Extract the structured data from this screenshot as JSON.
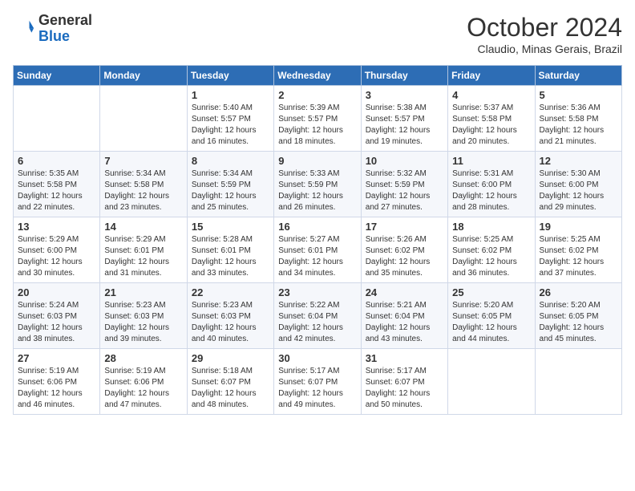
{
  "logo": {
    "general": "General",
    "blue": "Blue"
  },
  "header": {
    "month": "October 2024",
    "location": "Claudio, Minas Gerais, Brazil"
  },
  "days_of_week": [
    "Sunday",
    "Monday",
    "Tuesday",
    "Wednesday",
    "Thursday",
    "Friday",
    "Saturday"
  ],
  "weeks": [
    [
      {
        "day": "",
        "content": ""
      },
      {
        "day": "",
        "content": ""
      },
      {
        "day": "1",
        "content": "Sunrise: 5:40 AM\nSunset: 5:57 PM\nDaylight: 12 hours\nand 16 minutes."
      },
      {
        "day": "2",
        "content": "Sunrise: 5:39 AM\nSunset: 5:57 PM\nDaylight: 12 hours\nand 18 minutes."
      },
      {
        "day": "3",
        "content": "Sunrise: 5:38 AM\nSunset: 5:57 PM\nDaylight: 12 hours\nand 19 minutes."
      },
      {
        "day": "4",
        "content": "Sunrise: 5:37 AM\nSunset: 5:58 PM\nDaylight: 12 hours\nand 20 minutes."
      },
      {
        "day": "5",
        "content": "Sunrise: 5:36 AM\nSunset: 5:58 PM\nDaylight: 12 hours\nand 21 minutes."
      }
    ],
    [
      {
        "day": "6",
        "content": "Sunrise: 5:35 AM\nSunset: 5:58 PM\nDaylight: 12 hours\nand 22 minutes."
      },
      {
        "day": "7",
        "content": "Sunrise: 5:34 AM\nSunset: 5:58 PM\nDaylight: 12 hours\nand 23 minutes."
      },
      {
        "day": "8",
        "content": "Sunrise: 5:34 AM\nSunset: 5:59 PM\nDaylight: 12 hours\nand 25 minutes."
      },
      {
        "day": "9",
        "content": "Sunrise: 5:33 AM\nSunset: 5:59 PM\nDaylight: 12 hours\nand 26 minutes."
      },
      {
        "day": "10",
        "content": "Sunrise: 5:32 AM\nSunset: 5:59 PM\nDaylight: 12 hours\nand 27 minutes."
      },
      {
        "day": "11",
        "content": "Sunrise: 5:31 AM\nSunset: 6:00 PM\nDaylight: 12 hours\nand 28 minutes."
      },
      {
        "day": "12",
        "content": "Sunrise: 5:30 AM\nSunset: 6:00 PM\nDaylight: 12 hours\nand 29 minutes."
      }
    ],
    [
      {
        "day": "13",
        "content": "Sunrise: 5:29 AM\nSunset: 6:00 PM\nDaylight: 12 hours\nand 30 minutes."
      },
      {
        "day": "14",
        "content": "Sunrise: 5:29 AM\nSunset: 6:01 PM\nDaylight: 12 hours\nand 31 minutes."
      },
      {
        "day": "15",
        "content": "Sunrise: 5:28 AM\nSunset: 6:01 PM\nDaylight: 12 hours\nand 33 minutes."
      },
      {
        "day": "16",
        "content": "Sunrise: 5:27 AM\nSunset: 6:01 PM\nDaylight: 12 hours\nand 34 minutes."
      },
      {
        "day": "17",
        "content": "Sunrise: 5:26 AM\nSunset: 6:02 PM\nDaylight: 12 hours\nand 35 minutes."
      },
      {
        "day": "18",
        "content": "Sunrise: 5:25 AM\nSunset: 6:02 PM\nDaylight: 12 hours\nand 36 minutes."
      },
      {
        "day": "19",
        "content": "Sunrise: 5:25 AM\nSunset: 6:02 PM\nDaylight: 12 hours\nand 37 minutes."
      }
    ],
    [
      {
        "day": "20",
        "content": "Sunrise: 5:24 AM\nSunset: 6:03 PM\nDaylight: 12 hours\nand 38 minutes."
      },
      {
        "day": "21",
        "content": "Sunrise: 5:23 AM\nSunset: 6:03 PM\nDaylight: 12 hours\nand 39 minutes."
      },
      {
        "day": "22",
        "content": "Sunrise: 5:23 AM\nSunset: 6:03 PM\nDaylight: 12 hours\nand 40 minutes."
      },
      {
        "day": "23",
        "content": "Sunrise: 5:22 AM\nSunset: 6:04 PM\nDaylight: 12 hours\nand 42 minutes."
      },
      {
        "day": "24",
        "content": "Sunrise: 5:21 AM\nSunset: 6:04 PM\nDaylight: 12 hours\nand 43 minutes."
      },
      {
        "day": "25",
        "content": "Sunrise: 5:20 AM\nSunset: 6:05 PM\nDaylight: 12 hours\nand 44 minutes."
      },
      {
        "day": "26",
        "content": "Sunrise: 5:20 AM\nSunset: 6:05 PM\nDaylight: 12 hours\nand 45 minutes."
      }
    ],
    [
      {
        "day": "27",
        "content": "Sunrise: 5:19 AM\nSunset: 6:06 PM\nDaylight: 12 hours\nand 46 minutes."
      },
      {
        "day": "28",
        "content": "Sunrise: 5:19 AM\nSunset: 6:06 PM\nDaylight: 12 hours\nand 47 minutes."
      },
      {
        "day": "29",
        "content": "Sunrise: 5:18 AM\nSunset: 6:07 PM\nDaylight: 12 hours\nand 48 minutes."
      },
      {
        "day": "30",
        "content": "Sunrise: 5:17 AM\nSunset: 6:07 PM\nDaylight: 12 hours\nand 49 minutes."
      },
      {
        "day": "31",
        "content": "Sunrise: 5:17 AM\nSunset: 6:07 PM\nDaylight: 12 hours\nand 50 minutes."
      },
      {
        "day": "",
        "content": ""
      },
      {
        "day": "",
        "content": ""
      }
    ]
  ]
}
